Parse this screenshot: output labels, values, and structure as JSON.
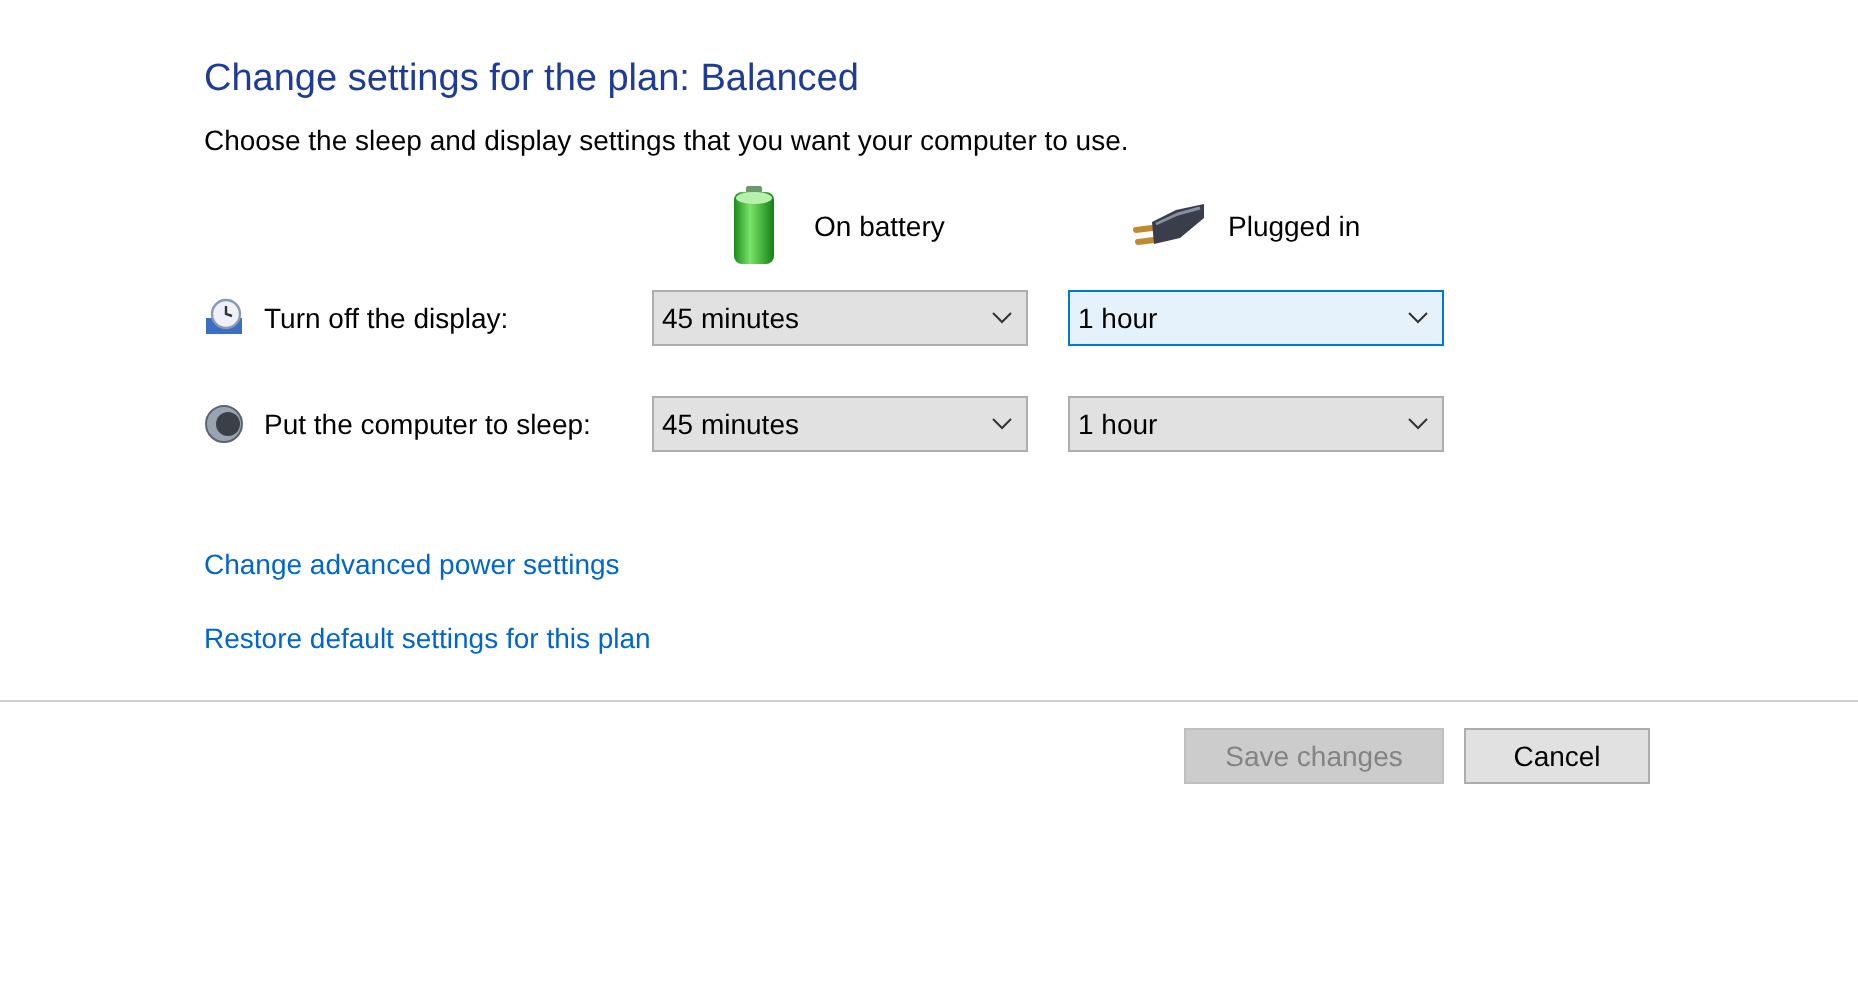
{
  "title": "Change settings for the plan: Balanced",
  "description": "Choose the sleep and display settings that you want your computer to use.",
  "columns": [
    {
      "kind": "battery",
      "label": "On battery"
    },
    {
      "kind": "plug",
      "label": "Plugged in"
    }
  ],
  "settings": [
    {
      "kind": "display",
      "label": "Turn off the display:",
      "values": [
        {
          "value": "45 minutes",
          "focused": false
        },
        {
          "value": "1 hour",
          "focused": true
        }
      ]
    },
    {
      "kind": "sleep",
      "label": "Put the computer to sleep:",
      "values": [
        {
          "value": "45 minutes",
          "focused": false
        },
        {
          "value": "1 hour",
          "focused": false
        }
      ]
    }
  ],
  "links": [
    "Change advanced power settings",
    "Restore default settings for this plan"
  ],
  "buttons": [
    {
      "label": "Save changes",
      "disabled": true
    },
    {
      "label": "Cancel",
      "disabled": false
    }
  ]
}
